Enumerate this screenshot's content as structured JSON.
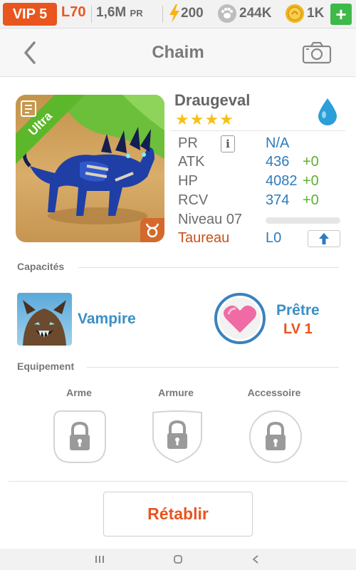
{
  "topbar": {
    "vip": "VIP 5",
    "level": "L70",
    "pr_value": "1,6M",
    "pr_unit": "PR",
    "energy": "200",
    "paw": "244K",
    "gold": "1K",
    "plus": "+"
  },
  "header": {
    "title": "Chaim",
    "back_icon": "chevron-left-icon",
    "camera_icon": "camera-icon"
  },
  "monster": {
    "rarity": "Ultra",
    "name": "Draugeval",
    "stars": "★★★★",
    "star_count": 4,
    "element_icon": "water-drop-icon",
    "stats": {
      "pr_label": "PR",
      "pr_value": "N/A",
      "atk_label": "ATK",
      "atk_value": "436",
      "atk_bonus": "+0",
      "hp_label": "HP",
      "hp_value": "4082",
      "hp_bonus": "+0",
      "rcv_label": "RCV",
      "rcv_value": "374",
      "rcv_bonus": "+0",
      "level_label": "Niveau 07",
      "level_progress": 0,
      "sign_label": "Taureau",
      "sign_value": "L0"
    }
  },
  "abilities": {
    "section_title": "Capacités",
    "skill_name": "Vampire",
    "leader_name": "Prêtre",
    "leader_level": "LV 1"
  },
  "equipment": {
    "section_title": "Equipement",
    "weapon": "Arme",
    "armor": "Armure",
    "accessory": "Accessoire"
  },
  "actions": {
    "reset": "Rétablir"
  },
  "colors": {
    "accent": "#e8551e",
    "blue": "#2f7bbd",
    "green": "#5cb030",
    "star": "#f6c117"
  }
}
